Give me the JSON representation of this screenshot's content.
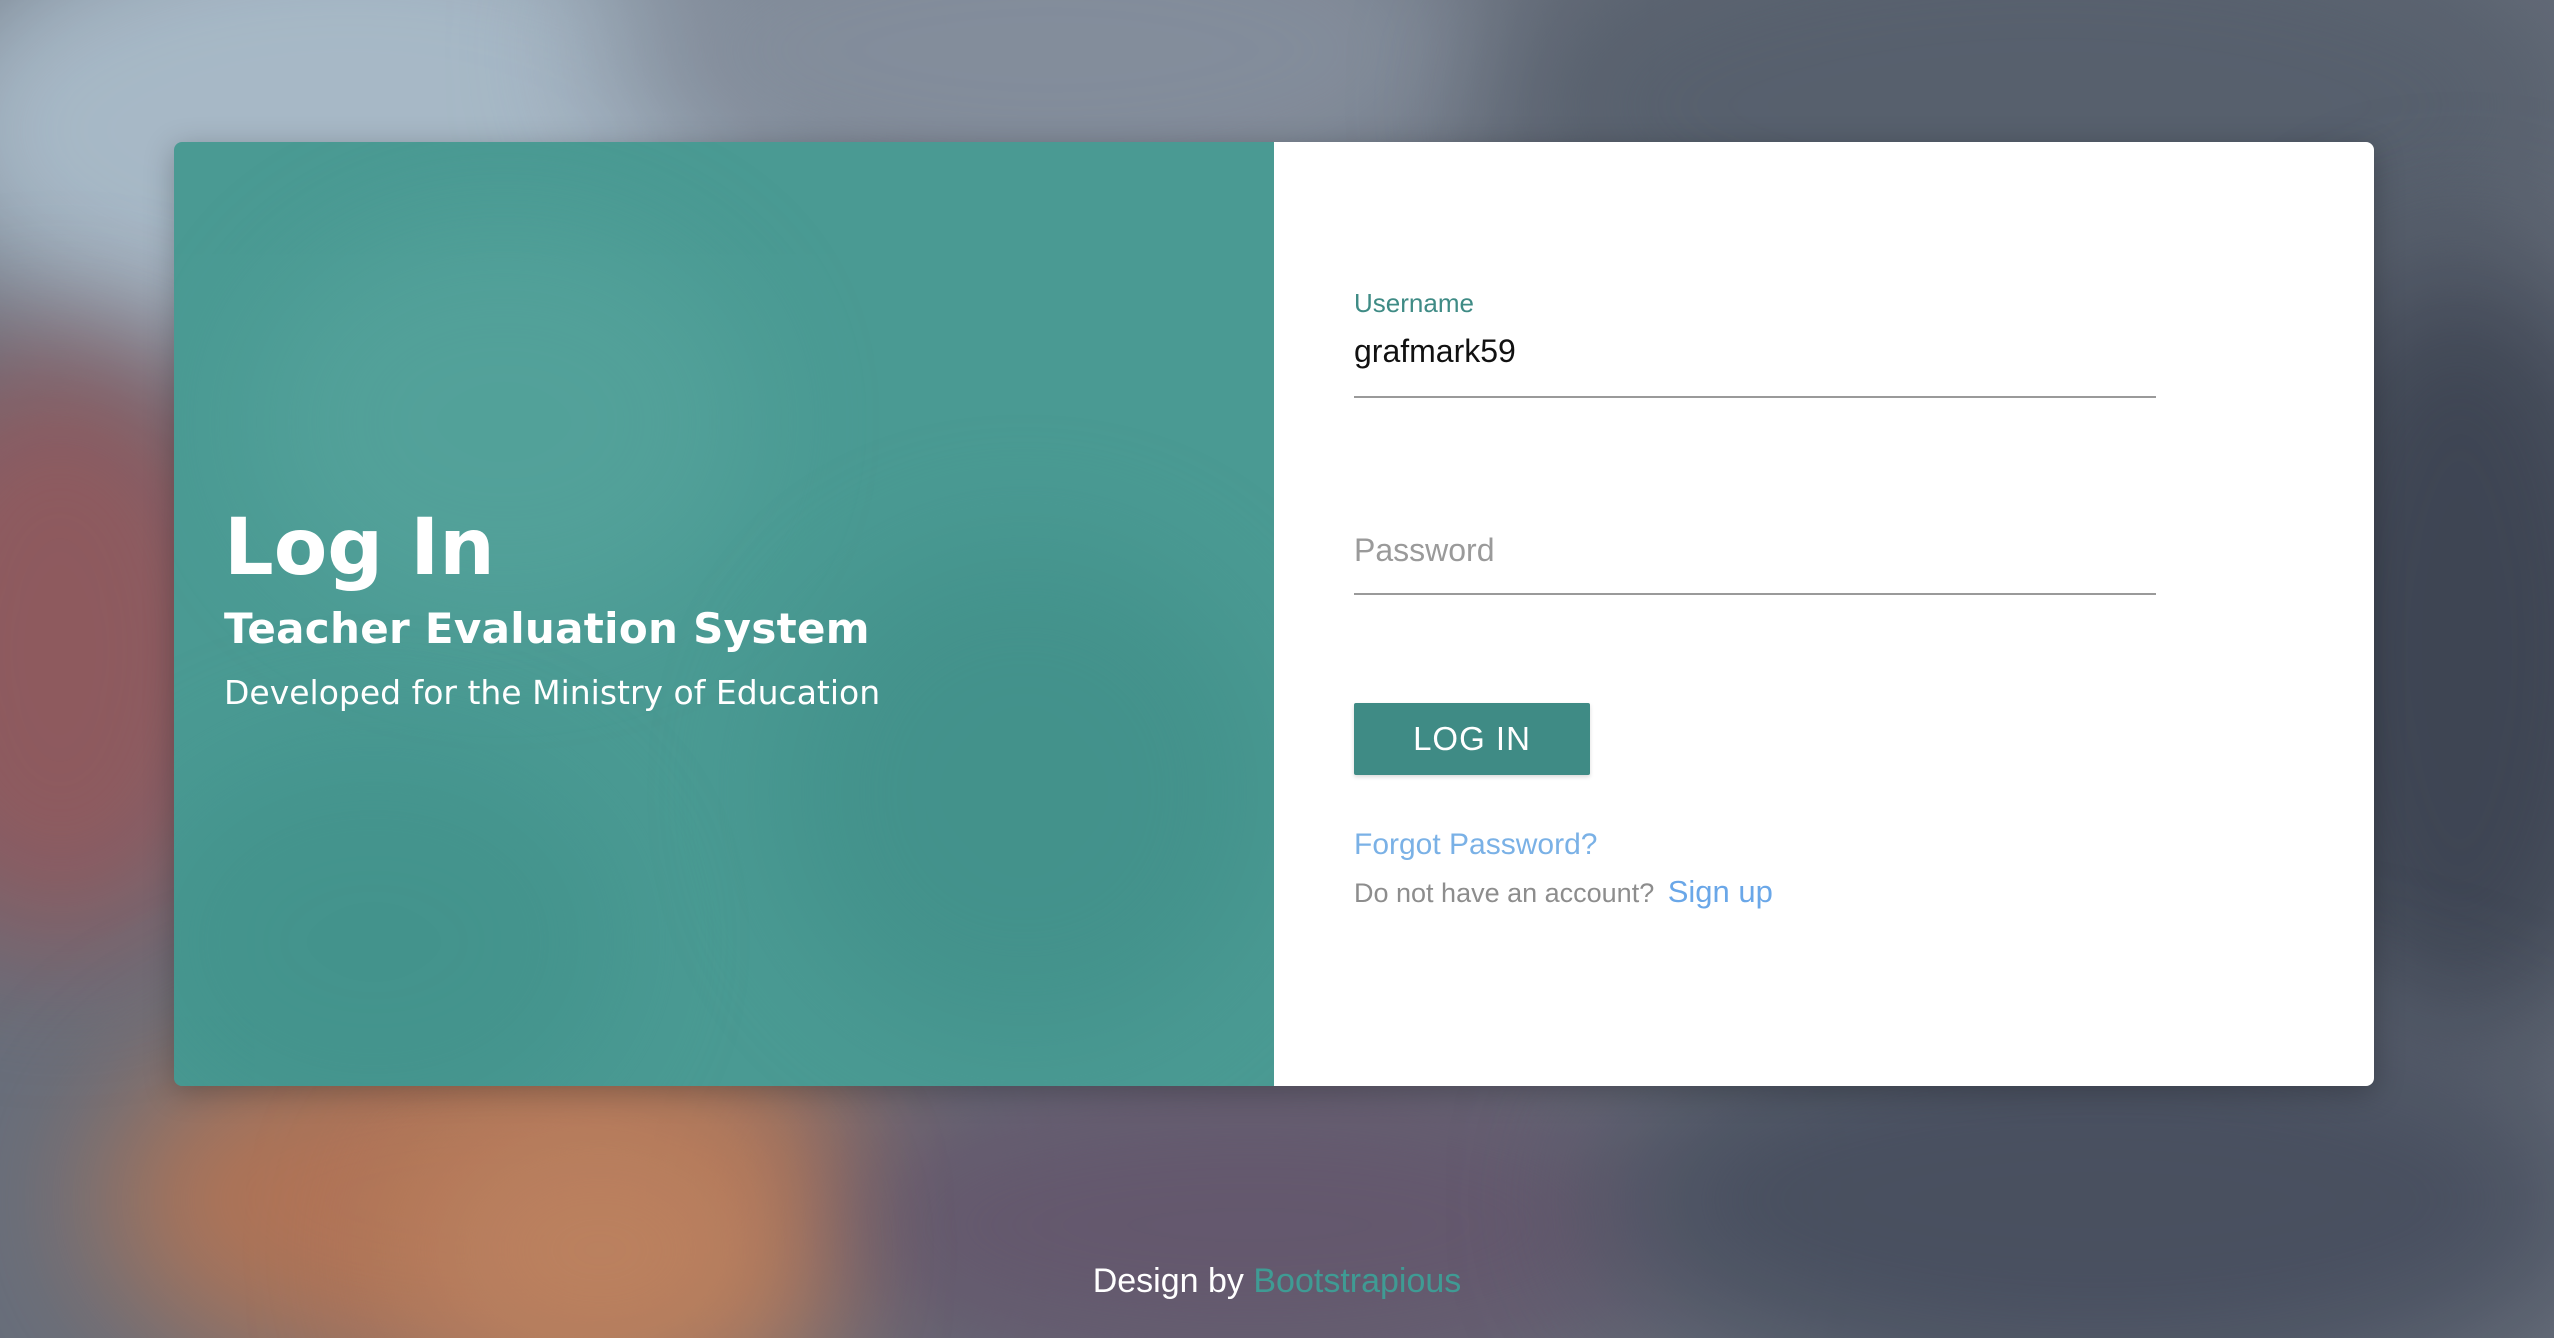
{
  "colors": {
    "accent": "#3f8b85",
    "panel_teal": "#4a9a93",
    "link_blue": "#7ab1e6"
  },
  "hero": {
    "title": "Log In",
    "subtitle": "Teacher Evaluation System",
    "tagline": "Developed for the Ministry of Education"
  },
  "form": {
    "username_label": "Username",
    "username_value": "grafmark59",
    "password_placeholder": "Password",
    "login_button": "LOG IN",
    "forgot_link": "Forgot Password?",
    "no_account_text": "Do not have an account?",
    "signup_link": "Sign up"
  },
  "footer": {
    "prefix": "Design by",
    "link": "Bootstrapious"
  }
}
